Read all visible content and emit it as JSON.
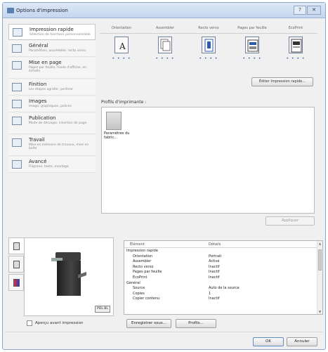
{
  "window": {
    "title": "Options d'impression",
    "close_glyph": "✕",
    "help_glyph": "?"
  },
  "nav": [
    {
      "id": "quick",
      "title": "Impression rapide",
      "desc": "Sélection de fonctions personnalisable"
    },
    {
      "id": "general",
      "title": "Général",
      "desc": "Paramètres, assemblée, recto verso"
    },
    {
      "id": "layout",
      "title": "Mise en page",
      "desc": "Pages par feuille, mode d'affiche, en échelle"
    },
    {
      "id": "finishing",
      "title": "Finition",
      "desc": "Les étapes agrafer, perforer"
    },
    {
      "id": "imaging",
      "title": "Images",
      "desc": "Image, graphiques, polices"
    },
    {
      "id": "publishing",
      "title": "Publication",
      "desc": "Mode de découpe, insertion de page"
    },
    {
      "id": "job",
      "title": "Travail",
      "desc": "Mise en mémoire de travaux, mise en boîte"
    },
    {
      "id": "advanced",
      "title": "Avancé",
      "desc": "Filigrane, texte, montage"
    }
  ],
  "quick_print": {
    "columns": [
      "Orientation",
      "Assembler",
      "Recto verso",
      "Pages par feuille",
      "EcoPrint"
    ],
    "dots": "• • • •",
    "edit_button": "Éditer Impression rapide..."
  },
  "profiles": {
    "label": "Profils d'imprimante :",
    "items": [
      {
        "name": "Paramètres du fabric..."
      }
    ],
    "apply_button": "Appliquer"
  },
  "preview": {
    "unit_badge": "POL BL",
    "checkbox_label": "Aperçu avant impression",
    "checked": false
  },
  "details": {
    "headers": [
      "Élément",
      "Détails"
    ],
    "rows": [
      {
        "group": true,
        "label": "Impression rapide",
        "value": ""
      },
      {
        "group": false,
        "label": "Orientation",
        "value": "Portrait"
      },
      {
        "group": false,
        "label": "Assembler",
        "value": "Activé"
      },
      {
        "group": false,
        "label": "Recto verso",
        "value": "Inactif"
      },
      {
        "group": false,
        "label": "Pages par feuille",
        "value": "Inactif"
      },
      {
        "group": false,
        "label": "EcoPrint",
        "value": "Inactif"
      },
      {
        "group": true,
        "label": "Général",
        "value": ""
      },
      {
        "group": false,
        "label": "Source",
        "value": "Auto de la source"
      },
      {
        "group": false,
        "label": "Copies",
        "value": "1"
      },
      {
        "group": false,
        "label": "Copier contenu",
        "value": "Inactif"
      }
    ]
  },
  "buttons": {
    "save_as": "Enregistrer sous...",
    "profile": "Profils...",
    "ok": "OK",
    "cancel": "Annuler"
  },
  "colors": {
    "title_bar": "#c4d6ee",
    "accent": "#2d5cab"
  }
}
